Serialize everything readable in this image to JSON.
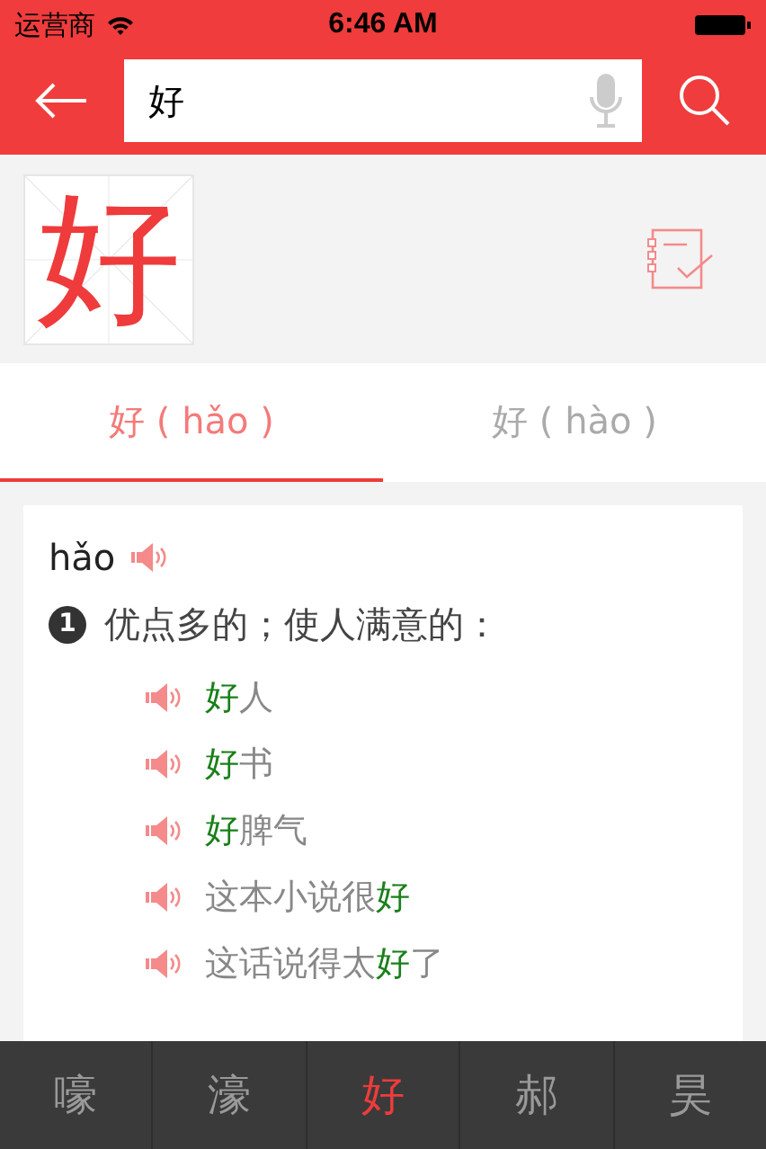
{
  "status_bar": {
    "carrier": "运营商",
    "time": "6:46 AM"
  },
  "search": {
    "value": "好"
  },
  "character": {
    "glyph": "好"
  },
  "tabs": [
    {
      "label": "好 ( hǎo )",
      "selected": true
    },
    {
      "label": "好 ( hào )",
      "selected": false
    }
  ],
  "entry": {
    "pinyin": "hǎo",
    "definitions": [
      {
        "number": "1",
        "text": "优点多的；使人满意的：",
        "examples": [
          [
            {
              "text": "好",
              "highlight": true
            },
            {
              "text": "人",
              "highlight": false
            }
          ],
          [
            {
              "text": "好",
              "highlight": true
            },
            {
              "text": "书",
              "highlight": false
            }
          ],
          [
            {
              "text": "好",
              "highlight": true
            },
            {
              "text": "脾气",
              "highlight": false
            }
          ],
          [
            {
              "text": "这本小说很",
              "highlight": false
            },
            {
              "text": "好",
              "highlight": true
            }
          ],
          [
            {
              "text": "这话说得太",
              "highlight": false
            },
            {
              "text": "好",
              "highlight": true
            },
            {
              "text": "了",
              "highlight": false
            }
          ]
        ]
      }
    ]
  },
  "related_characters": [
    {
      "char": "嚎",
      "selected": false
    },
    {
      "char": "濠",
      "selected": false
    },
    {
      "char": "好",
      "selected": true
    },
    {
      "char": "郝",
      "selected": false
    },
    {
      "char": "昊",
      "selected": false
    }
  ]
}
